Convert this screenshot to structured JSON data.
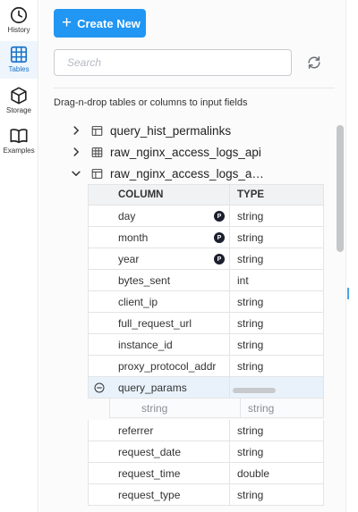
{
  "rail": {
    "items": [
      {
        "label": "History",
        "icon": "clock-icon"
      },
      {
        "label": "Tables",
        "icon": "table-grid-icon",
        "active": true
      },
      {
        "label": "Storage",
        "icon": "cube-icon"
      },
      {
        "label": "Examples",
        "icon": "book-icon"
      }
    ]
  },
  "toolbar": {
    "create_label": "Create New",
    "search_placeholder": "Search",
    "search_value": ""
  },
  "hint": "Drag-n-drop tables or columns to input fields",
  "tree": [
    {
      "name": "query_hist_permalinks",
      "expanded": false,
      "icon": "table-icon"
    },
    {
      "name": "raw_nginx_access_logs_api",
      "expanded": false,
      "icon": "table-grid-icon"
    },
    {
      "name": "raw_nginx_access_logs_a…",
      "expanded": true,
      "icon": "table-icon"
    }
  ],
  "columns": {
    "headers": [
      "COLUMN",
      "TYPE"
    ],
    "partition_badge": "P",
    "rows": [
      {
        "name": "day",
        "type": "string",
        "partition": true
      },
      {
        "name": "month",
        "type": "string",
        "partition": true
      },
      {
        "name": "year",
        "type": "string",
        "partition": true
      },
      {
        "name": "bytes_sent",
        "type": "int"
      },
      {
        "name": "client_ip",
        "type": "string"
      },
      {
        "name": "full_request_url",
        "type": "string"
      },
      {
        "name": "instance_id",
        "type": "string"
      },
      {
        "name": "proxy_protocol_addr",
        "type": "string"
      },
      {
        "name": "query_params",
        "type": "",
        "expanded": true
      },
      {
        "name": "referrer",
        "type": "string"
      },
      {
        "name": "request_date",
        "type": "string"
      },
      {
        "name": "request_time",
        "type": "double"
      },
      {
        "name": "request_type",
        "type": "string"
      }
    ],
    "sub_row": {
      "key": "string",
      "value": "string"
    }
  },
  "colors": {
    "accent": "#2196f3",
    "active_rail": "#1a73c8",
    "partition_badge": "#1c1f2e"
  }
}
